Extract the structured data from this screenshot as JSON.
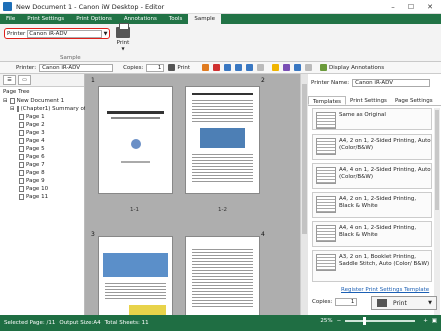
{
  "window": {
    "title": "New Document 1 - Canon iW Desktop - Editor",
    "controls": [
      "–",
      "☐",
      "✕"
    ]
  },
  "ribbon_tabs": [
    "File",
    "Print Settings",
    "Print Options",
    "Annotations",
    "Tools",
    "Sample"
  ],
  "active_tab": "Sample",
  "ribbon": {
    "printer_label": "Printer",
    "printer_value": "Canon iR-ADV",
    "print_label": "Print",
    "group_label": "Sample"
  },
  "toolbar": {
    "printer_label": "Printer:",
    "printer_value": "Canon iR-ADV",
    "copies_label": "Copies:",
    "copies_value": "1",
    "print_label": "Print",
    "display_annotations": "Display Annotations"
  },
  "left_pane": {
    "title": "Page Tree",
    "root": "New Document 1",
    "chapter": "(Chapter1) Summary of R...",
    "pages": [
      "Page 1",
      "Page 2",
      "Page 3",
      "Page 4",
      "Page 5",
      "Page 6",
      "Page 7",
      "Page 8",
      "Page 9",
      "Page 10",
      "Page 11"
    ]
  },
  "center": {
    "chapter_numbers": [
      "1",
      "2",
      "3",
      "4"
    ],
    "page_labels": [
      "1-1",
      "1-2"
    ]
  },
  "right_pane": {
    "printer_name_label": "Printer Name:",
    "printer_name_value": "Canon iR-ADV",
    "tabs": [
      "Templates",
      "Print Settings",
      "Page Settings"
    ],
    "templates": [
      "Same as Original",
      "A4, 2 on 1, 2-Sided Printing, Auto (Color/B&W)",
      "A4, 4 on 1, 2-Sided Printing, Auto (Color/B&W)",
      "A4, 2 on 1, 2-Sided Printing, Black & White",
      "A4, 4 on 1, 2-Sided Printing, Black & White",
      "A3, 2 on 1, Booklet Printing, Saddle Stitch, Auto (Color/ B&W)"
    ],
    "register_link": "Register Print Settings Template",
    "copies_label": "Copies:",
    "copies_value": "1",
    "print_button": "Print"
  },
  "status": {
    "selected_page": "Selected Page: /11",
    "output_size": "Output Size:A4",
    "total_sheets": "Total Sheets: 11",
    "zoom": "25%"
  },
  "colors": {
    "ribbon": "#217346",
    "highlight": "#e0201a",
    "status": "#1f6e43",
    "link": "#1b5fb4"
  }
}
